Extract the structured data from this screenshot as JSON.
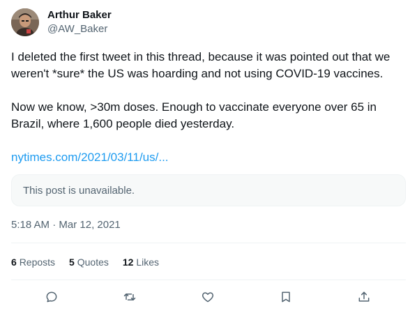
{
  "author": {
    "display_name": "Arthur Baker",
    "handle": "@AW_Baker",
    "avatar_icon": "profile-photo"
  },
  "body": {
    "paragraph_1": "I deleted the first tweet in this thread, because it was pointed out that we weren't *sure* the US was hoarding and not using COVID-19 vaccines.",
    "paragraph_2": "Now we know, >30m doses. Enough to vaccinate everyone over 65 in Brazil, where 1,600 people died yesterday."
  },
  "link": {
    "text": "nytimes.com/2021/03/11/us/..."
  },
  "quoted": {
    "text": "This post is unavailable."
  },
  "timestamp": {
    "time": "5:18 AM",
    "separator": " · ",
    "date": "Mar 12, 2021"
  },
  "stats": {
    "reposts_count": "6",
    "reposts_label": "Reposts",
    "quotes_count": "5",
    "quotes_label": "Quotes",
    "likes_count": "12",
    "likes_label": "Likes"
  },
  "actions": [
    {
      "icon": "reply-icon"
    },
    {
      "icon": "repost-icon"
    },
    {
      "icon": "like-icon"
    },
    {
      "icon": "bookmark-icon"
    },
    {
      "icon": "share-icon"
    }
  ],
  "colors": {
    "text_primary": "#0f1419",
    "text_secondary": "#536471",
    "link": "#1d9bf0",
    "divider": "#eff3f4",
    "card_bg": "#f7f9f9"
  }
}
